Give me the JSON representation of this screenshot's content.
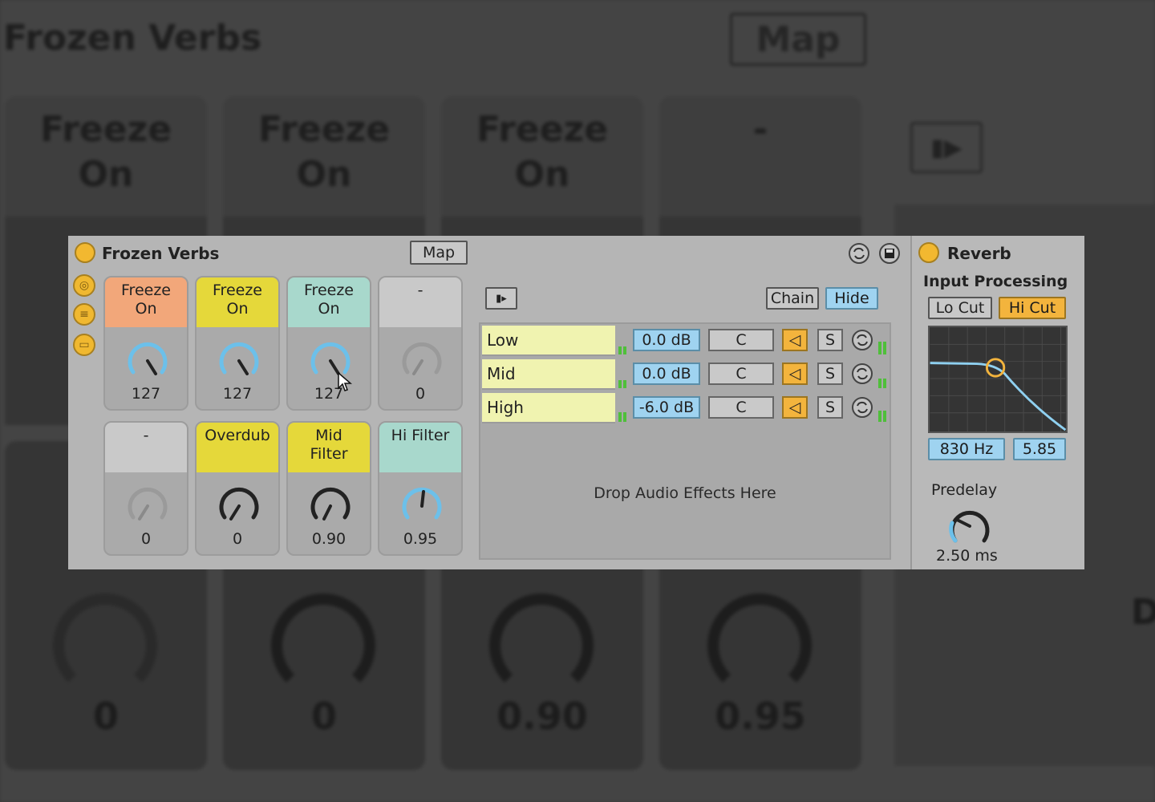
{
  "background": {
    "title": "Frozen Verbs",
    "map_label": "Map",
    "pads": [
      "Freeze\nOn",
      "Freeze\nOn",
      "Freeze\nOn",
      "-"
    ],
    "values": [
      "0",
      "0",
      "0.90",
      "0.95"
    ],
    "play_icon": "▮▶",
    "partial_letter": "D"
  },
  "rack": {
    "title": "Frozen Verbs",
    "map_label": "Map",
    "chain_label": "Chain",
    "hide_label": "Hide",
    "play_icon": "▮▸",
    "macros": [
      {
        "label": "Freeze On",
        "value": "127",
        "color": "#f2a77a"
      },
      {
        "label": "Freeze On",
        "value": "127",
        "color": "#e5d83a"
      },
      {
        "label": "Freeze On",
        "value": "127",
        "color": "#a8d8cc"
      },
      {
        "label": "-",
        "value": "0",
        "color": "#c9c9c9"
      },
      {
        "label": "-",
        "value": "0",
        "color": "#c9c9c9"
      },
      {
        "label": "Overdub",
        "value": "0",
        "color": "#e5d83a"
      },
      {
        "label": "Mid Filter",
        "value": "0.90",
        "color": "#e5d83a"
      },
      {
        "label": "Hi Filter",
        "value": "0.95",
        "color": "#a8d8cc"
      }
    ],
    "chains": [
      {
        "name": "Low",
        "gain": "0.0 dB",
        "pan": "C",
        "solo": "S"
      },
      {
        "name": "Mid",
        "gain": "0.0 dB",
        "pan": "C",
        "solo": "S"
      },
      {
        "name": "High",
        "gain": "-6.0 dB",
        "pan": "C",
        "solo": "S"
      }
    ],
    "drop_text": "Drop Audio Effects Here"
  },
  "reverb": {
    "title": "Reverb",
    "section": "Input Processing",
    "lo_cut": "Lo Cut",
    "hi_cut": "Hi Cut",
    "freq": "830 Hz",
    "q": "5.85",
    "predelay_label": "Predelay",
    "predelay_value": "2.50 ms"
  },
  "colors": {
    "accent_orange": "#f3b43d",
    "accent_blue": "#9fd3f0",
    "knob_blue": "#6cc0ea",
    "meter_green": "#4fbf3a"
  }
}
